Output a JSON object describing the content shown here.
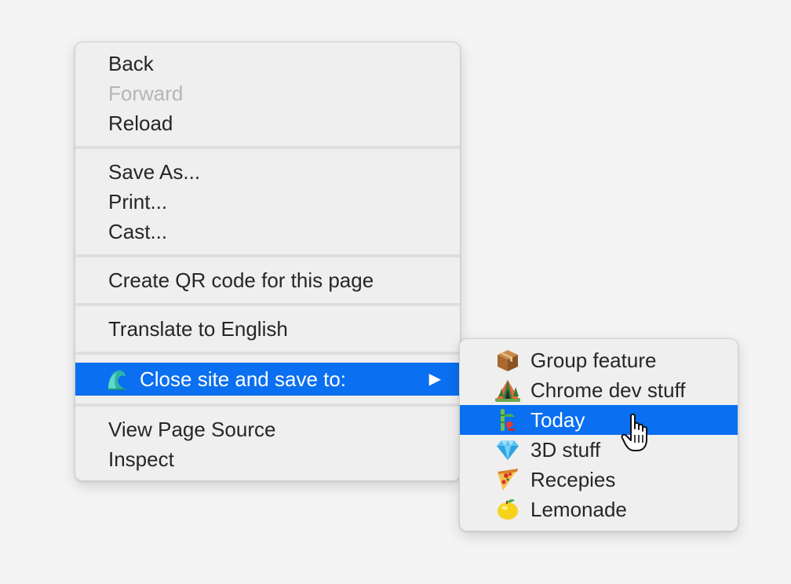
{
  "main_menu": {
    "items": [
      {
        "label": "Back",
        "enabled": true
      },
      {
        "label": "Forward",
        "enabled": false
      },
      {
        "label": "Reload",
        "enabled": true
      },
      {
        "label": "Save As...",
        "enabled": true
      },
      {
        "label": "Print...",
        "enabled": true
      },
      {
        "label": "Cast...",
        "enabled": true
      },
      {
        "label": "Create QR code for this page",
        "enabled": true
      },
      {
        "label": "Translate to English",
        "enabled": true
      },
      {
        "label": "Close site and save to:",
        "enabled": true,
        "highlighted": true,
        "icon": "wave-icon",
        "has_submenu": true
      },
      {
        "label": "View Page Source",
        "enabled": true
      },
      {
        "label": "Inspect",
        "enabled": true
      }
    ],
    "submenu_arrow": "▶"
  },
  "sub_menu": {
    "items": [
      {
        "label": "Group feature",
        "icon": "package-icon"
      },
      {
        "label": "Chrome dev stuff",
        "icon": "camping-tent-icon"
      },
      {
        "label": "Today",
        "icon": "bamboo-icon",
        "highlighted": true
      },
      {
        "label": "3D stuff",
        "icon": "gem-icon"
      },
      {
        "label": "Recepies",
        "icon": "pizza-icon"
      },
      {
        "label": "Lemonade",
        "icon": "lemon-icon"
      }
    ]
  },
  "colors": {
    "highlight": "#0a6ff0",
    "menu_bg": "#efefef",
    "disabled_text": "#b5b5b5"
  }
}
